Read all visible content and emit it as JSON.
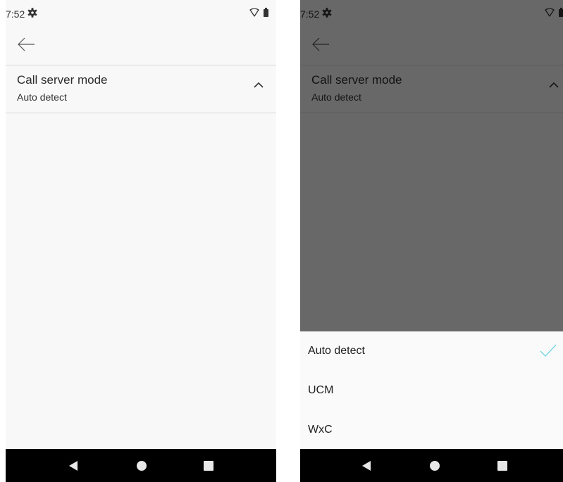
{
  "status_bar": {
    "time": "7:52",
    "settings_icon": "gear-icon",
    "wifi_icon": "wifi-icon",
    "battery_icon": "battery-icon"
  },
  "toolbar": {
    "back_icon": "arrow-left-icon"
  },
  "preference": {
    "title": "Call server mode",
    "summary": "Auto detect",
    "expand_icon": "chevron-up-icon"
  },
  "dialog": {
    "options": [
      {
        "label": "Auto detect",
        "selected": true
      },
      {
        "label": "UCM",
        "selected": false
      },
      {
        "label": "WxC",
        "selected": false
      }
    ],
    "selected_icon": "check-icon",
    "accent_color": "#5fd0e0"
  },
  "nav_bar": {
    "back_icon": "nav-back-icon",
    "home_icon": "nav-home-icon",
    "recents_icon": "nav-recents-icon"
  }
}
